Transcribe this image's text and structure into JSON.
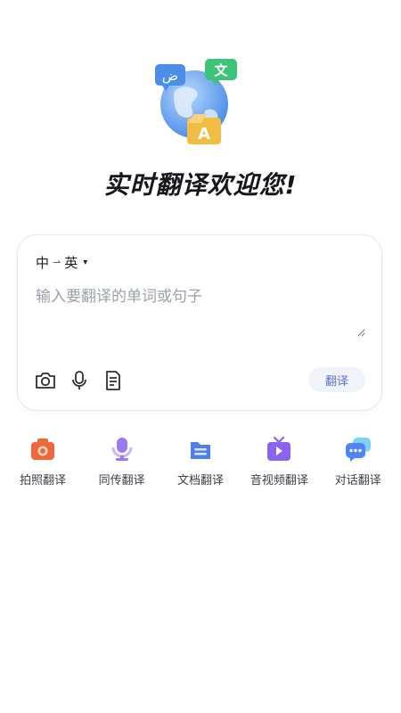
{
  "hero": {
    "icon": "globe-translate-illustration",
    "bubble_left": "ض",
    "bubble_right": "文",
    "bubble_bottom": "A"
  },
  "headline": "实时翻译欢迎您!",
  "card": {
    "lang_from": "中",
    "lang_arrow": "⇀",
    "lang_to": "英",
    "lang_caret": "▾",
    "placeholder": "输入要翻译的单词或句子",
    "input_value": "",
    "translate_label": "翻译",
    "tools": [
      "camera-icon",
      "microphone-icon",
      "document-icon"
    ]
  },
  "features": [
    {
      "label": "拍照翻译",
      "icon": "photo-translate-icon",
      "color": "#f0673a"
    },
    {
      "label": "同传翻译",
      "icon": "simultaneous-translate-icon",
      "color": "#9a7af0"
    },
    {
      "label": "文档翻译",
      "icon": "document-translate-icon",
      "color": "#4f7ef0"
    },
    {
      "label": "音视频翻译",
      "icon": "video-translate-icon",
      "color": "#8a64ee"
    },
    {
      "label": "对话翻译",
      "icon": "dialog-translate-icon",
      "color": "#4f86f7"
    }
  ],
  "colors": {
    "accent": "#5b6fd6",
    "placeholder": "#9aa0aa",
    "headline": "#15171c"
  }
}
